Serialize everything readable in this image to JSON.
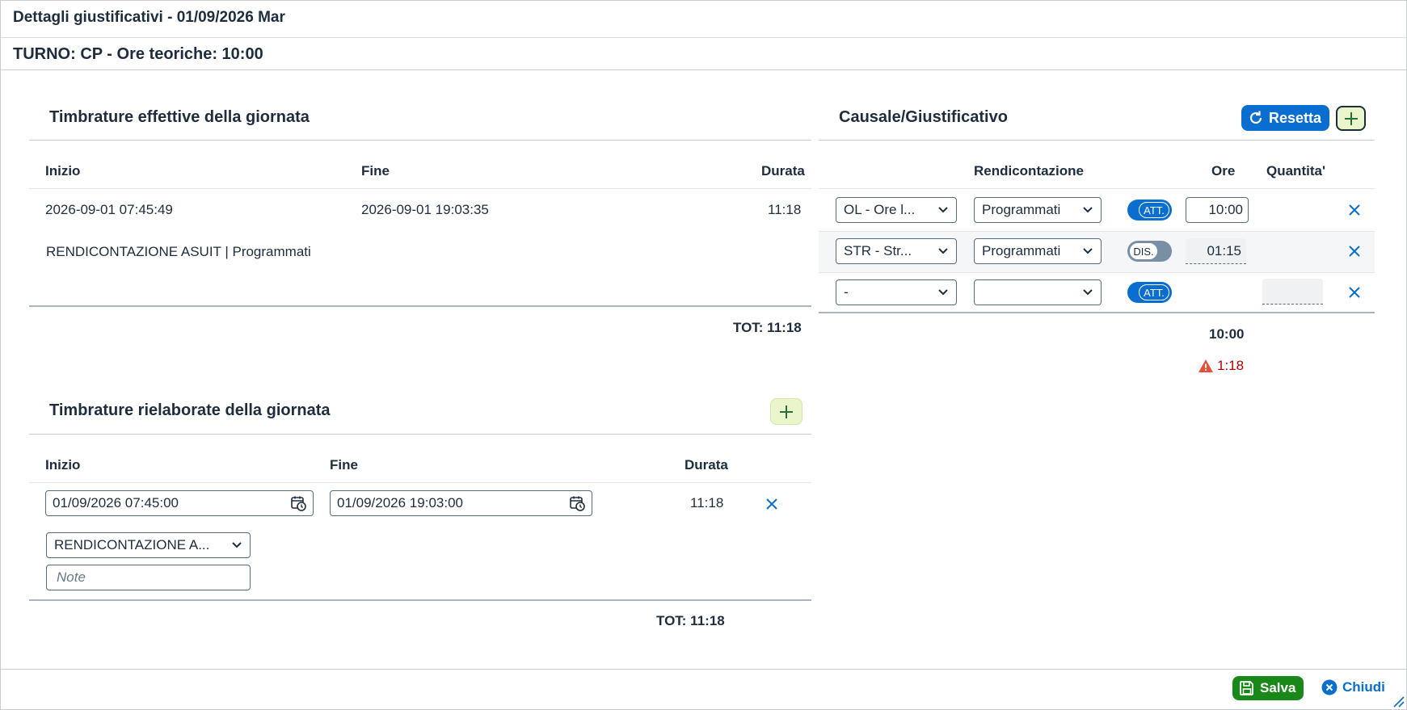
{
  "header": {
    "title": "Dettagli giustificativi - 01/09/2026 Mar",
    "turno": "TURNO: CP - Ore teoriche: 10:00"
  },
  "effettive": {
    "title": "Timbrature effettive della giornata",
    "columns": {
      "inizio": "Inizio",
      "fine": "Fine",
      "durata": "Durata"
    },
    "rows": [
      {
        "inizio": "2026-09-01 07:45:49",
        "fine": "2026-09-01 19:03:35",
        "durata": "11:18",
        "note": "RENDICONTAZIONE ASUIT | Programmati"
      }
    ],
    "total": "TOT: 11:18"
  },
  "rielaborate": {
    "title": "Timbrature rielaborate della giornata",
    "columns": {
      "inizio": "Inizio",
      "fine": "Fine",
      "durata": "Durata"
    },
    "rows": [
      {
        "inizio": "01/09/2026 07:45:00",
        "fine": "01/09/2026 19:03:00",
        "durata": "11:18",
        "rendicontazione": "RENDICONTAZIONE A...",
        "note_placeholder": "Note"
      }
    ],
    "total": "TOT: 11:18"
  },
  "causale": {
    "title": "Causale/Giustificativo",
    "reset_label": "Resetta",
    "columns": {
      "rendicontazione": "Rendicontazione",
      "ore": "Ore",
      "quantita": "Quantita'"
    },
    "rows": [
      {
        "causale": "OL - Ore l...",
        "rendicontazione": "Programmati",
        "toggle": "ATT.",
        "toggle_on": true,
        "ore": "10:00"
      },
      {
        "causale": "STR - Str...",
        "rendicontazione": "Programmati",
        "toggle": "DIS.",
        "toggle_on": false,
        "ore": "01:15"
      },
      {
        "causale": "-",
        "rendicontazione": "",
        "toggle": "ATT.",
        "toggle_on": true,
        "ore": ""
      }
    ],
    "total": "10:00",
    "warning": "1:18"
  },
  "footer": {
    "save_label": "Salva",
    "close_label": "Chiudi"
  },
  "colors": {
    "primary": "#0a6ed1",
    "success": "#188918",
    "error": "#bb0000",
    "add_bg": "#ebf5cb"
  }
}
